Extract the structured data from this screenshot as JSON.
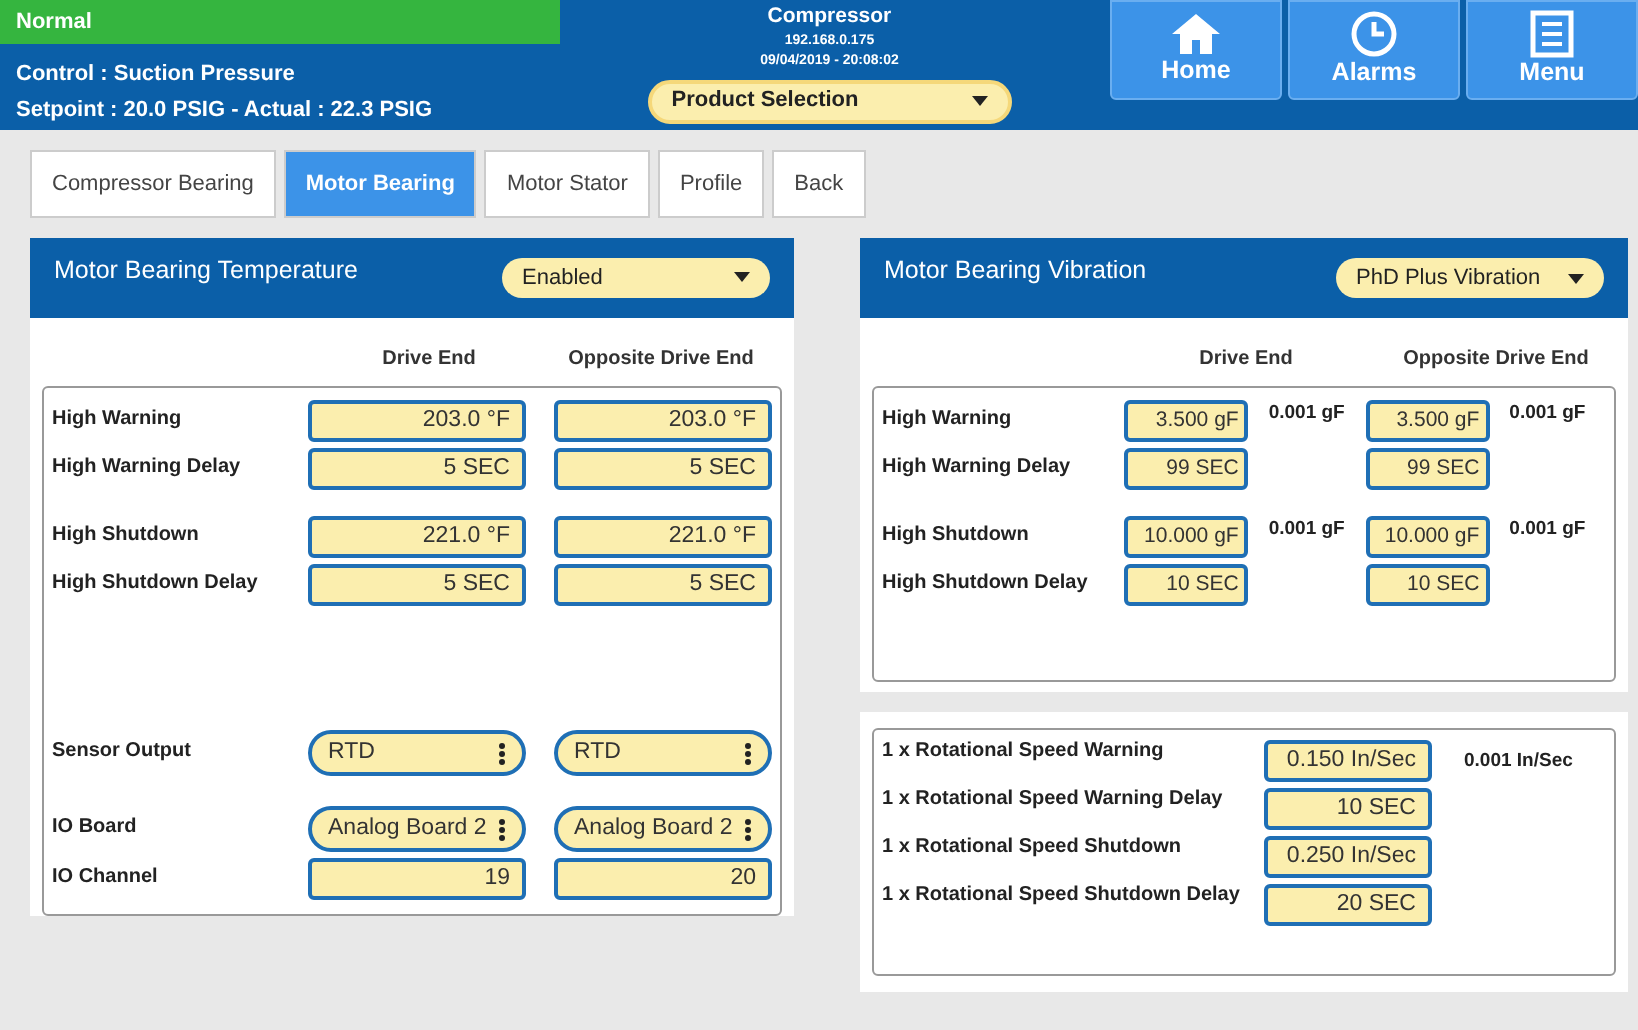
{
  "header": {
    "status": "Normal",
    "control": "Control : Suction Pressure",
    "setpoint": "Setpoint : 20.0 PSIG - Actual : 22.3 PSIG",
    "title": "Compressor",
    "ip": "192.168.0.175",
    "datetime": "09/04/2019 - 20:08:02",
    "product_selection": "Product Selection",
    "nav_buttons": [
      {
        "label": "Home",
        "kind": "home"
      },
      {
        "label": "Alarms",
        "kind": "alarms"
      },
      {
        "label": "Menu",
        "kind": "menu"
      }
    ]
  },
  "tabs": [
    {
      "label": "Compressor Bearing",
      "selected": false
    },
    {
      "label": "Motor Bearing",
      "selected": true
    },
    {
      "label": "Motor Stator",
      "selected": false
    },
    {
      "label": "Profile",
      "selected": false
    },
    {
      "label": "Back",
      "selected": false
    }
  ],
  "temperature_panel": {
    "title": "Motor Bearing Temperature",
    "mode": "Enabled",
    "columns": [
      "Drive End",
      "Opposite Drive End"
    ],
    "limit_groups": [
      [
        {
          "label": "High Warning",
          "values": [
            "203.0 °F",
            "203.0 °F"
          ]
        },
        {
          "label": "High Warning Delay",
          "values": [
            "5 SEC",
            "5 SEC"
          ]
        }
      ],
      [
        {
          "label": "High Shutdown",
          "values": [
            "221.0 °F",
            "221.0 °F"
          ]
        },
        {
          "label": "High Shutdown Delay",
          "values": [
            "5 SEC",
            "5 SEC"
          ]
        }
      ]
    ],
    "sensor_rows": [
      {
        "label": "Sensor Output",
        "kind": "select",
        "values": [
          "RTD",
          "RTD"
        ]
      },
      {
        "label": "IO Board",
        "kind": "select",
        "values": [
          "Analog Board 2",
          "Analog Board 2"
        ]
      },
      {
        "label": "IO Channel",
        "kind": "field",
        "values": [
          "19",
          "20"
        ]
      }
    ]
  },
  "vibration_panel": {
    "title": "Motor Bearing Vibration",
    "mode": "PhD Plus Vibration",
    "columns": [
      "Drive End",
      "Opposite Drive End"
    ],
    "limit_groups": [
      [
        {
          "label": "High Warning",
          "cells": [
            {
              "value": "3.500 gF",
              "resolution": "0.001 gF"
            },
            {
              "value": "3.500 gF",
              "resolution": "0.001 gF"
            }
          ]
        },
        {
          "label": "High Warning Delay",
          "cells": [
            {
              "value": "99 SEC"
            },
            {
              "value": "99 SEC"
            }
          ]
        }
      ],
      [
        {
          "label": "High Shutdown",
          "cells": [
            {
              "value": "10.000 gF",
              "resolution": "0.001 gF"
            },
            {
              "value": "10.000 gF",
              "resolution": "0.001 gF"
            }
          ]
        },
        {
          "label": "High Shutdown Delay",
          "cells": [
            {
              "value": "10 SEC"
            },
            {
              "value": "10 SEC"
            }
          ]
        }
      ]
    ]
  },
  "rotational_panel": {
    "rows": [
      {
        "label": "1 x Rotational Speed Warning",
        "value": "0.150 In/Sec",
        "resolution": "0.001 In/Sec"
      },
      {
        "label": "1 x Rotational Speed Warning Delay",
        "value": "10 SEC"
      },
      {
        "label": "1 x Rotational Speed Shutdown",
        "value": "0.250 In/Sec"
      },
      {
        "label": "1 x Rotational Speed Shutdown Delay",
        "value": "20 SEC"
      }
    ]
  }
}
